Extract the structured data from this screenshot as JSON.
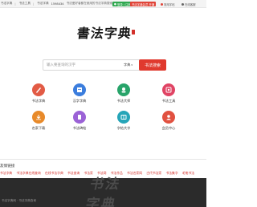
{
  "topbar": {
    "links": [
      "书法字典",
      "书法工具",
      "书法字典"
    ],
    "count": "1598434",
    "slogan": "书法爱好者都在使用的书法字典搜索查询工具",
    "login": "登录 / 注册",
    "vip": "书法字典会员 开通",
    "item1": "常用字帖",
    "item2": "在线客服",
    "colors": {
      "login": "#2fa84f",
      "vip": "#e04438"
    }
  },
  "logo": {
    "text": "書法字典"
  },
  "search": {
    "placeholder": "输入要查询的汉字",
    "select_value": "字典",
    "button": "书法搜索"
  },
  "grid": [
    {
      "label": "书法字典",
      "icon": "brush-icon",
      "color": "#e25b45"
    },
    {
      "label": "汉字字典",
      "icon": "dictionary-icon",
      "color": "#3b7ddd"
    },
    {
      "label": "书法大师",
      "icon": "master-icon",
      "color": "#28a46a"
    },
    {
      "label": "书法工具",
      "icon": "tools-icon",
      "color": "#e04464"
    },
    {
      "label": "名家下载",
      "icon": "download-icon",
      "color": "#e88a2a"
    },
    {
      "label": "书法碑帖",
      "icon": "stele-icon",
      "color": "#9b62d6"
    },
    {
      "label": "字帖大字",
      "icon": "copybook-icon",
      "color": "#26a5b8"
    },
    {
      "label": "会员中心",
      "icon": "user-icon",
      "color": "#e15140"
    }
  ],
  "links": {
    "title": "友情链接",
    "items": [
      "书法字典",
      "书法字典在线查询",
      "在线书法字典",
      "书法查询",
      "书法家",
      "书法网",
      "书法作品",
      "书法名家网",
      "古代书法家",
      "书法集字",
      "毛笔书法"
    ]
  },
  "footer": {
    "mark": "书法字典",
    "copy": "书法字典网 · 书法字典查询"
  }
}
